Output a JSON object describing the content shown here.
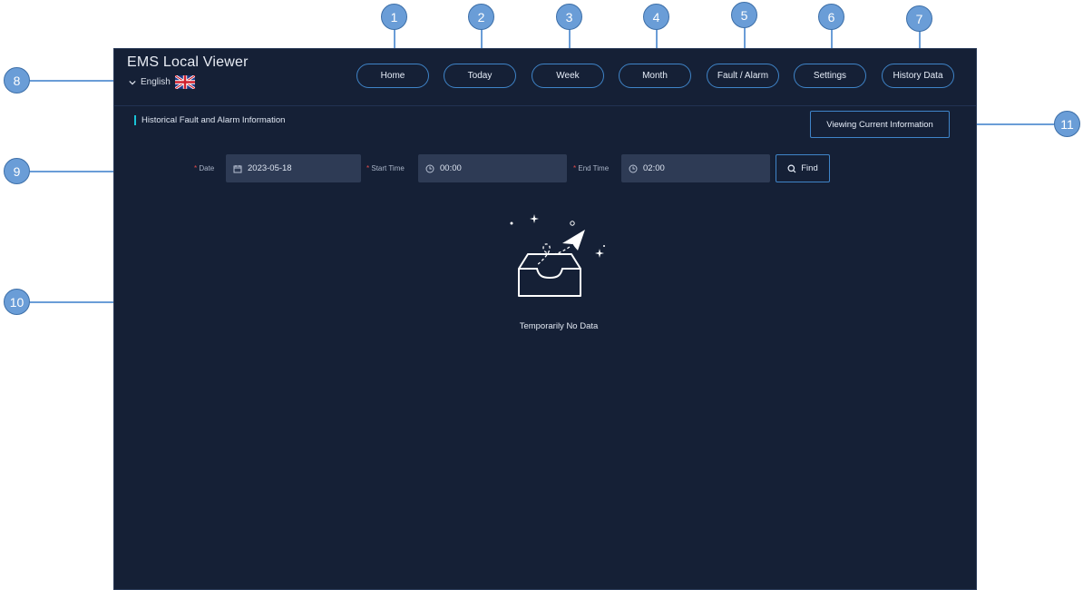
{
  "app": {
    "title": "EMS Local Viewer",
    "language": "English"
  },
  "nav": [
    "Home",
    "Today",
    "Week",
    "Month",
    "Fault / Alarm",
    "Settings",
    "History Data"
  ],
  "section": {
    "title": "Historical Fault and Alarm Information",
    "current_button": "Viewing Current Information"
  },
  "filters": {
    "date_label": "Date",
    "date_value": "2023-05-18",
    "start_label": "Start Time",
    "start_value": "00:00",
    "end_label": "End Time",
    "end_value": "02:00",
    "find_label": "Find",
    "required_mark": "*"
  },
  "empty_state": "Temporarily No Data",
  "callouts": [
    "1",
    "2",
    "3",
    "4",
    "5",
    "6",
    "7",
    "8",
    "9",
    "10",
    "11"
  ],
  "colors": {
    "background": "#152036",
    "accent": "#3f84c8",
    "section_bar": "#19c3d6",
    "field": "#2e3b55",
    "callout": "#6a9dd7"
  }
}
